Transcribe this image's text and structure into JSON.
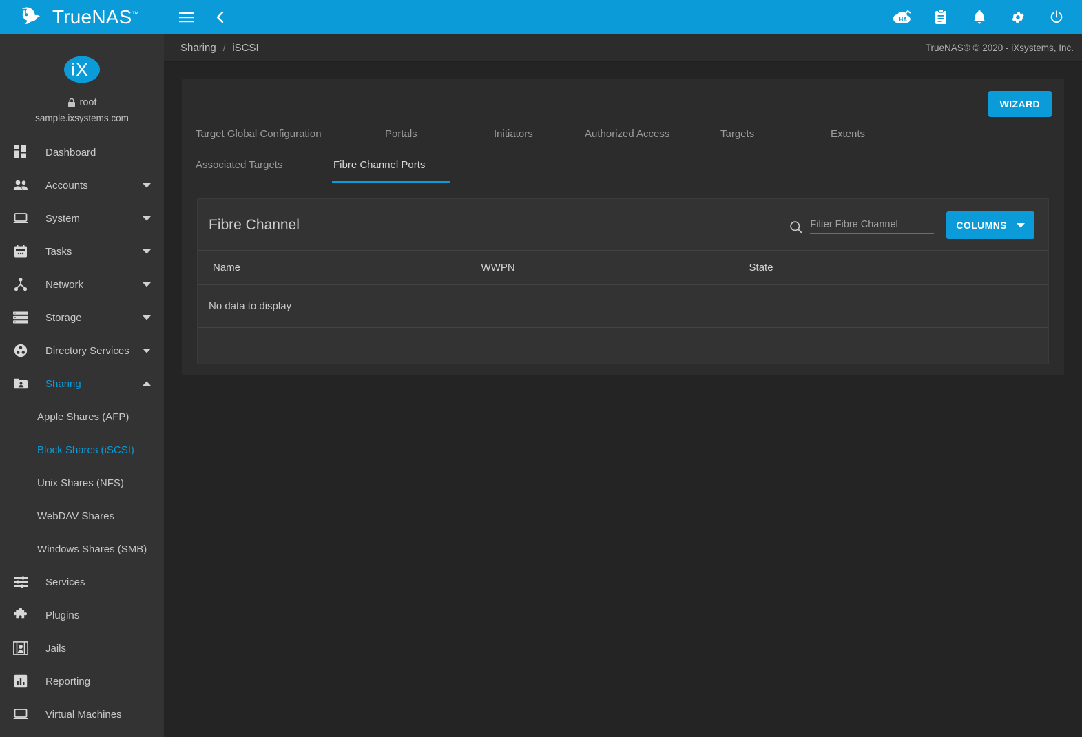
{
  "brand": {
    "name": "TrueNAS",
    "tm": "™"
  },
  "topbar": {
    "menu_icon": "hamburger-menu-icon",
    "back_icon": "chevron-left-icon",
    "icons": [
      {
        "name": "ha-status-icon",
        "label": "HA"
      },
      {
        "name": "task-manager-icon",
        "label": "Task Manager"
      },
      {
        "name": "notifications-bell-icon",
        "label": "Notifications"
      },
      {
        "name": "settings-gear-icon",
        "label": "Settings"
      },
      {
        "name": "power-icon",
        "label": "Power"
      }
    ]
  },
  "sidebar": {
    "user": "root",
    "lock_icon": "lock-icon",
    "hostname": "sample.ixsystems.com",
    "logo": "ix-systems-logo",
    "items": [
      {
        "label": "Dashboard",
        "icon": "dashboard-icon",
        "expandable": false,
        "active": false
      },
      {
        "label": "Accounts",
        "icon": "accounts-people-icon",
        "expandable": true,
        "active": false
      },
      {
        "label": "System",
        "icon": "system-laptop-icon",
        "expandable": true,
        "active": false
      },
      {
        "label": "Tasks",
        "icon": "tasks-calendar-icon",
        "expandable": true,
        "active": false
      },
      {
        "label": "Network",
        "icon": "network-icon",
        "expandable": true,
        "active": false
      },
      {
        "label": "Storage",
        "icon": "storage-icon",
        "expandable": true,
        "active": false
      },
      {
        "label": "Directory Services",
        "icon": "directory-services-icon",
        "expandable": true,
        "active": false
      },
      {
        "label": "Sharing",
        "icon": "sharing-folder-icon",
        "expandable": true,
        "active": true,
        "expanded": true
      }
    ],
    "sharing_subitems": [
      {
        "label": "Apple Shares (AFP)",
        "active": false
      },
      {
        "label": "Block Shares (iSCSI)",
        "active": true
      },
      {
        "label": "Unix Shares (NFS)",
        "active": false
      },
      {
        "label": "WebDAV Shares",
        "active": false
      },
      {
        "label": "Windows Shares (SMB)",
        "active": false
      }
    ],
    "items_after": [
      {
        "label": "Services",
        "icon": "services-sliders-icon",
        "expandable": false,
        "active": false
      },
      {
        "label": "Plugins",
        "icon": "plugins-puzzle-icon",
        "expandable": false,
        "active": false
      },
      {
        "label": "Jails",
        "icon": "jails-icon",
        "expandable": false,
        "active": false
      },
      {
        "label": "Reporting",
        "icon": "reporting-chart-icon",
        "expandable": false,
        "active": false
      },
      {
        "label": "Virtual Machines",
        "icon": "virtual-machines-icon",
        "expandable": false,
        "active": false
      }
    ]
  },
  "breadcrumb": {
    "parent": "Sharing",
    "separator": "/",
    "current": "iSCSI"
  },
  "copyright": "TrueNAS® © 2020 - iXsystems, Inc.",
  "main": {
    "wizard_label": "WIZARD",
    "tabs": [
      {
        "label": "Target Global Configuration",
        "active": false
      },
      {
        "label": "Portals",
        "active": false
      },
      {
        "label": "Initiators",
        "active": false
      },
      {
        "label": "Authorized Access",
        "active": false
      },
      {
        "label": "Targets",
        "active": false
      },
      {
        "label": "Extents",
        "active": false
      },
      {
        "label": "Associated Targets",
        "active": false
      },
      {
        "label": "Fibre Channel Ports",
        "active": true
      }
    ]
  },
  "table_card": {
    "title": "Fibre Channel",
    "search_icon": "search-icon",
    "filter_placeholder": "Filter Fibre Channel",
    "filter_value": "",
    "columns_label": "COLUMNS",
    "columns_caret_icon": "chevron-down-icon",
    "headers": [
      "Name",
      "WWPN",
      "State",
      ""
    ],
    "rows": [],
    "empty_message": "No data to display"
  },
  "colors": {
    "accent": "#0a9bd8",
    "topbar": "#0a9bd8",
    "sidebar_bg": "#333333",
    "content_bg": "#242424",
    "panel_bg": "#2c2c2c",
    "card_bg": "#333333",
    "text_primary": "#d2d2d2",
    "text_muted": "#9a9a9a"
  }
}
